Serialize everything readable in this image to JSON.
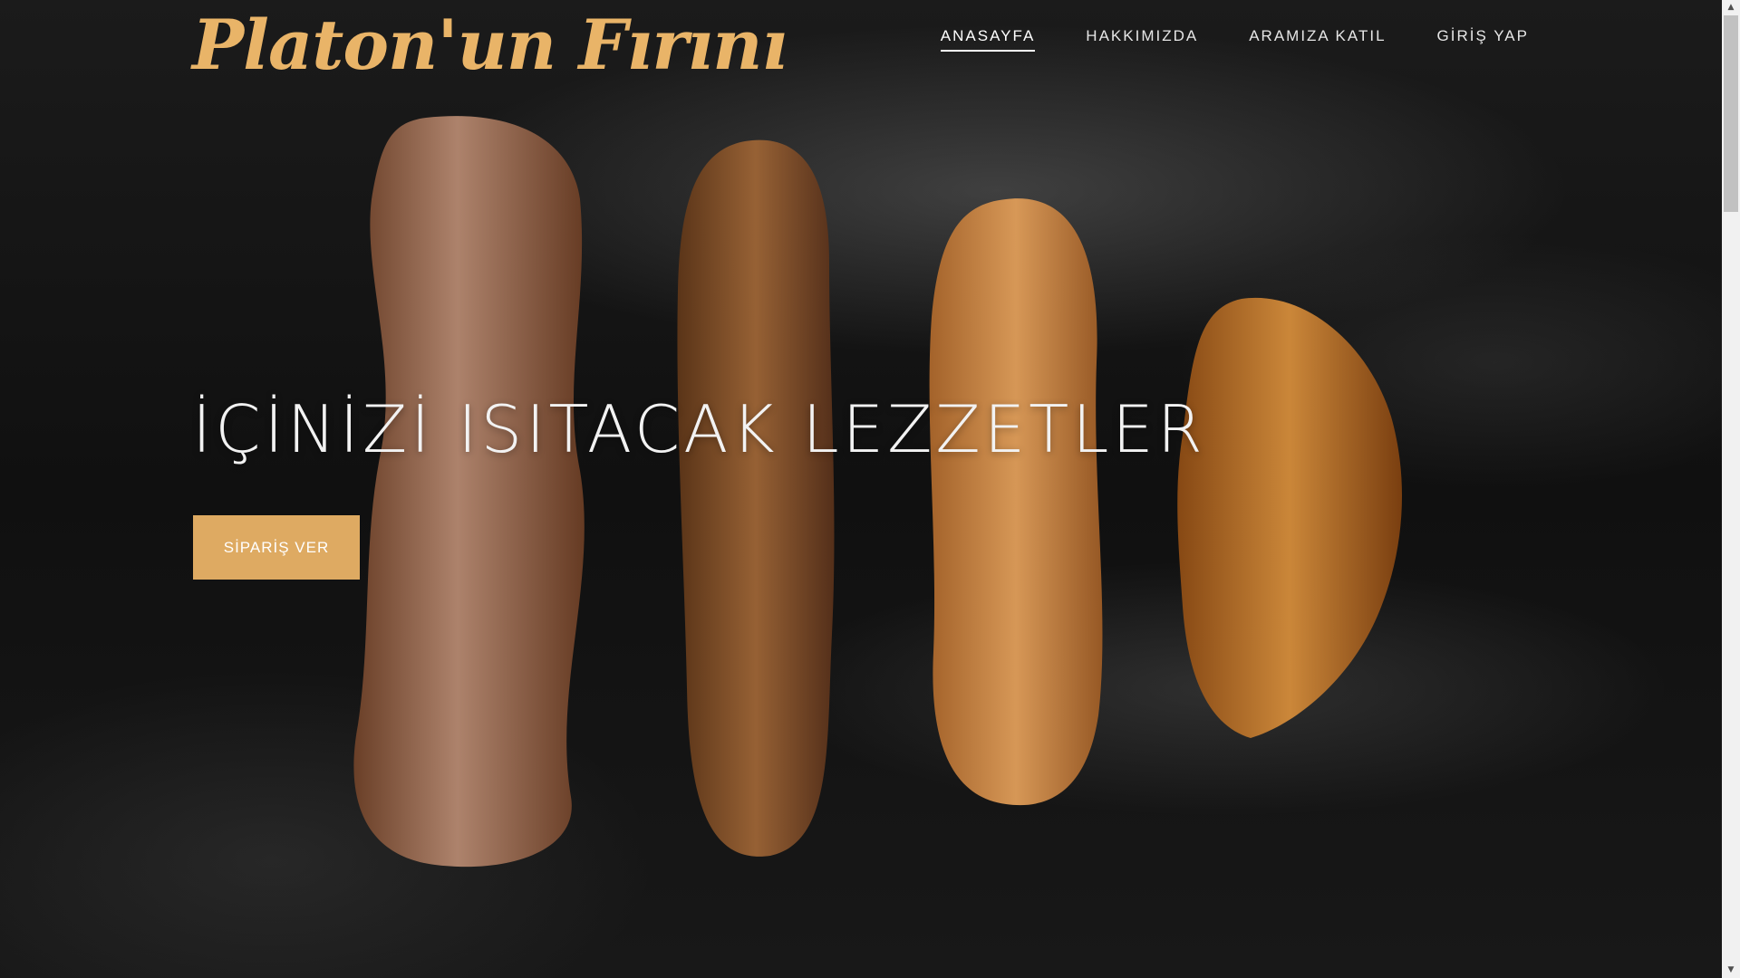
{
  "brand": {
    "logo_text": "Platon'un Fırını",
    "accent_color": "#deaa62"
  },
  "nav": {
    "items": [
      {
        "label": "ANASAYFA",
        "active": true
      },
      {
        "label": "HAKKIMIZDA",
        "active": false
      },
      {
        "label": "ARAMIZA KATIL",
        "active": false
      },
      {
        "label": "GİRİŞ YAP",
        "active": false
      }
    ]
  },
  "hero": {
    "headline": "İÇİNİZİ ISITACAK LEZZETLER",
    "cta_label": "SİPARİŞ VER",
    "background_image": "breads-on-dark-flour-surface"
  },
  "scrollbar": {
    "up_icon": "scroll-up-arrow-icon",
    "down_icon": "scroll-down-arrow-icon"
  }
}
